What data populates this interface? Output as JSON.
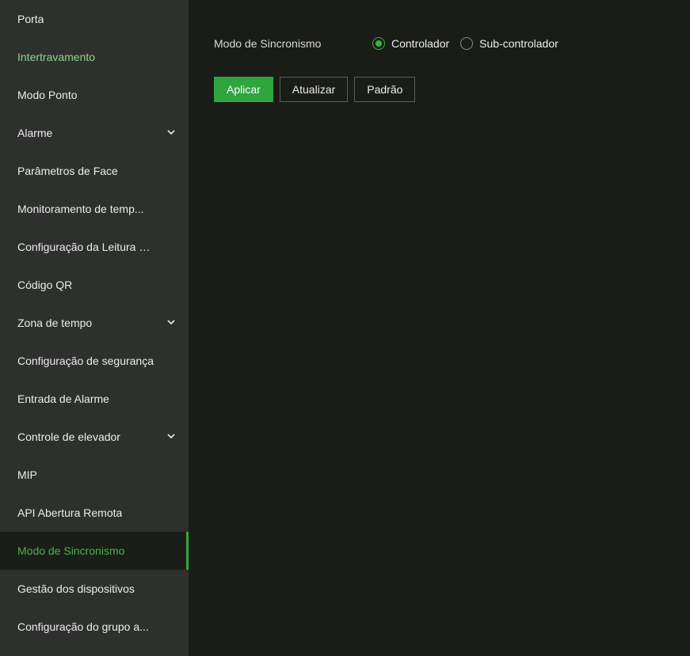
{
  "sidebar": {
    "items": [
      {
        "label": "Porta"
      },
      {
        "label": "Intertravamento"
      },
      {
        "label": "Modo Ponto"
      },
      {
        "label": "Alarme"
      },
      {
        "label": "Parâmetros de Face"
      },
      {
        "label": "Monitoramento de temp..."
      },
      {
        "label": "Configuração da Leitura d..."
      },
      {
        "label": "Código QR"
      },
      {
        "label": "Zona de tempo"
      },
      {
        "label": "Configuração de segurança"
      },
      {
        "label": "Entrada de Alarme"
      },
      {
        "label": "Controle de elevador"
      },
      {
        "label": "MIP"
      },
      {
        "label": "API Abertura Remota"
      },
      {
        "label": "Modo de Sincronismo"
      },
      {
        "label": "Gestão dos dispositivos"
      },
      {
        "label": "Configuração do grupo a..."
      }
    ],
    "active_item": "Modo de Sincronismo",
    "expandable_items": [
      "Alarme",
      "Zona de tempo",
      "Controle de elevador"
    ],
    "chevron_icon": "chevron-down-icon"
  },
  "form": {
    "label": "Modo de Sincronismo",
    "options": [
      {
        "label": "Controlador",
        "checked": true
      },
      {
        "label": "Sub-controlador",
        "checked": false
      }
    ]
  },
  "buttons": {
    "apply": "Aplicar",
    "refresh": "Atualizar",
    "default": "Padrão"
  },
  "colors": {
    "accent": "#2ea53d",
    "active_text": "#45b445",
    "sidebar_bg": "#2e302e",
    "main_bg": "#1a1c18"
  }
}
